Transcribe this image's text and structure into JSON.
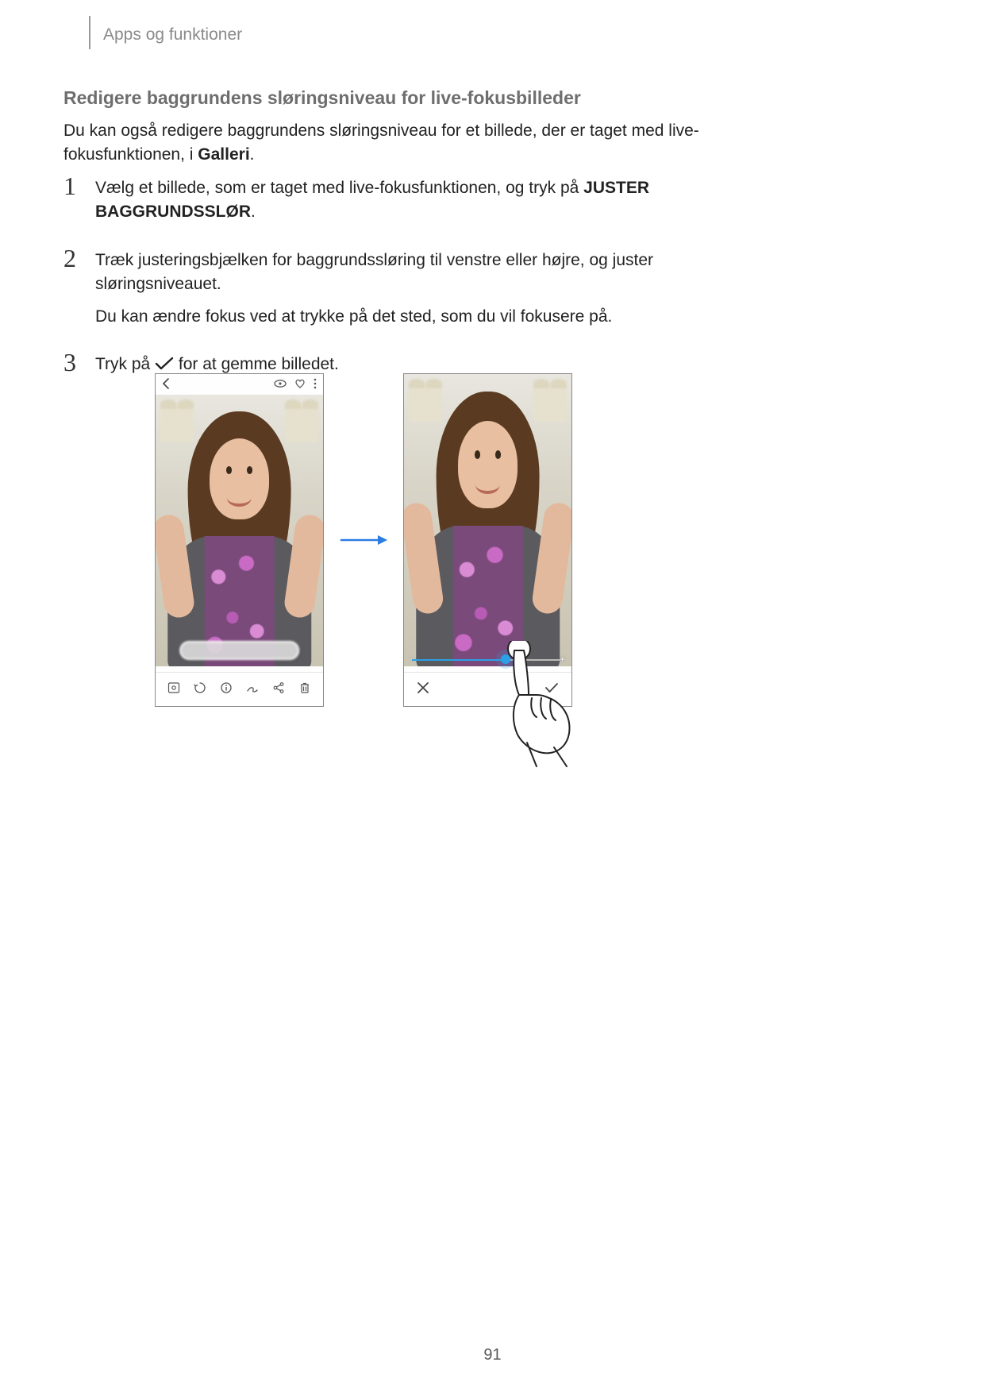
{
  "breadcrumb": "Apps og funktioner",
  "section_title": "Redigere baggrundens sløringsniveau for live-fokusbilleder",
  "intro_before": "Du kan også redigere baggrundens sløringsniveau for et billede, der er taget med live-fokusfunktionen, i ",
  "intro_bold": "Galleri",
  "intro_after": ".",
  "steps": {
    "s1a": "Vælg et billede, som er taget med live-fokusfunktionen, og tryk på ",
    "s1b": "JUSTER BAGGRUNDSSLØR",
    "s1c": ".",
    "s2a": "Træk justeringsbjælken for baggrundssløring til venstre eller højre, og juster sløringsniveauet.",
    "s2b": "Du kan ændre fokus ved at trykke på det sted, som du vil fokusere på.",
    "s3a": "Tryk på ",
    "s3b": " for at gemme billedet."
  },
  "nums": {
    "n1": "1",
    "n2": "2",
    "n3": "3"
  },
  "slider_minus": "−",
  "slider_plus": "+",
  "page_number": "91"
}
